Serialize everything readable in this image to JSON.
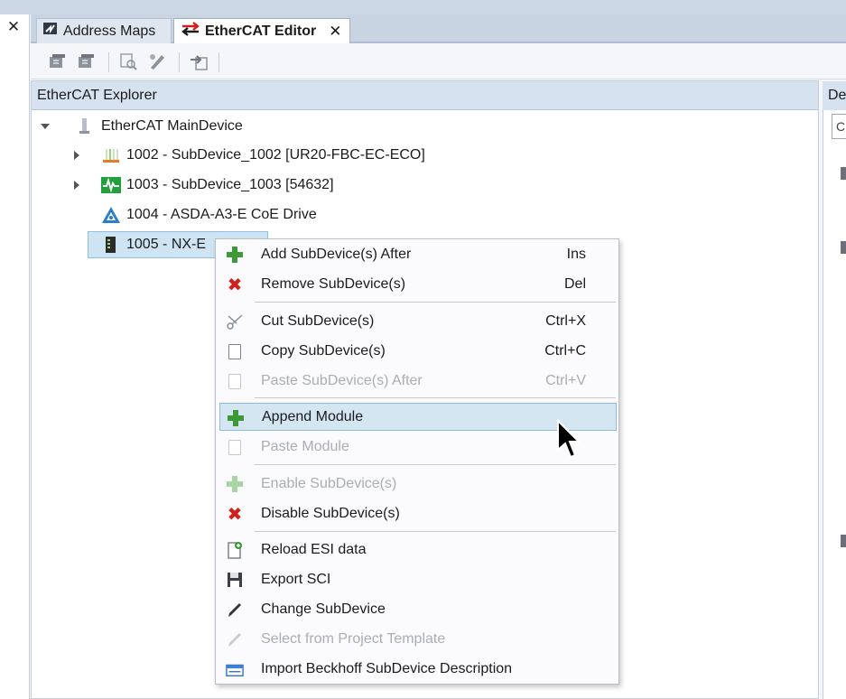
{
  "left_panel": {
    "close_glyph": "✕"
  },
  "tabs": [
    {
      "label": "Address Maps",
      "icon": "address-maps-icon",
      "active": false
    },
    {
      "label": "EtherCAT Editor",
      "icon": "ethercat-swap-icon",
      "active": true,
      "close_glyph": "✕"
    }
  ],
  "toolbar": {
    "buttons": [
      "add-device-icon",
      "remove-device-icon",
      "scan-icon",
      "edit-icon",
      "export-icon"
    ]
  },
  "explorer": {
    "title": "EtherCAT Explorer",
    "tree": [
      {
        "label": "EtherCAT MainDevice",
        "level": 0,
        "expanded": true,
        "icon": "maindevice-icon"
      },
      {
        "label": "1002 - SubDevice_1002 [UR20-FBC-EC-ECO]",
        "level": 1,
        "expandable": true,
        "icon": "io-rack-icon"
      },
      {
        "label": "1003 - SubDevice_1003 [54632]",
        "level": 1,
        "expandable": true,
        "icon": "green-signal-icon"
      },
      {
        "label": "1004 - ASDA-A3-E CoE Drive",
        "level": 1,
        "expandable": false,
        "icon": "delta-drive-icon"
      },
      {
        "label": "1005 - NX-E",
        "level": 1,
        "expandable": false,
        "icon": "nx-coupler-icon",
        "selected": true
      }
    ]
  },
  "right_panel": {
    "header_fragment": "De",
    "field_fragment": "C"
  },
  "context_menu": {
    "items": [
      {
        "label": "Add SubDevice(s) After",
        "shortcut": "Ins",
        "icon": "green-plus-icon",
        "enabled": true
      },
      {
        "label": "Remove SubDevice(s)",
        "shortcut": "Del",
        "icon": "red-x-icon",
        "enabled": true
      },
      {
        "label": "Cut SubDevice(s)",
        "shortcut": "Ctrl+X",
        "icon": "scissors-icon",
        "enabled": true
      },
      {
        "label": "Copy SubDevice(s)",
        "shortcut": "Ctrl+C",
        "icon": "copy-icon",
        "enabled": true
      },
      {
        "label": "Paste SubDevice(s) After",
        "shortcut": "Ctrl+V",
        "icon": "paste-icon",
        "enabled": false
      },
      {
        "label": "Append Module",
        "shortcut": "",
        "icon": "green-plus-icon",
        "enabled": true,
        "hovered": true
      },
      {
        "label": "Paste Module",
        "shortcut": "",
        "icon": "paste-icon",
        "enabled": false
      },
      {
        "label": "Enable SubDevice(s)",
        "shortcut": "",
        "icon": "green-plus-icon",
        "enabled": false
      },
      {
        "label": "Disable SubDevice(s)",
        "shortcut": "",
        "icon": "red-x-icon",
        "enabled": true
      },
      {
        "label": "Reload ESI data",
        "shortcut": "",
        "icon": "reload-file-icon",
        "enabled": true
      },
      {
        "label": "Export SCI",
        "shortcut": "",
        "icon": "save-disk-icon",
        "enabled": true
      },
      {
        "label": "Change SubDevice",
        "shortcut": "",
        "icon": "pencil-icon",
        "enabled": true
      },
      {
        "label": "Select from Project Template",
        "shortcut": "",
        "icon": "pencil-icon",
        "enabled": false
      },
      {
        "label": "Import Beckhoff SubDevice Description",
        "shortcut": "",
        "icon": "import-device-icon",
        "enabled": true
      }
    ]
  },
  "colors": {
    "accent_plus": "#3c9a36",
    "danger_x": "#d0201b",
    "selection": "#cfe4f2",
    "hover": "#d4e6f2"
  }
}
